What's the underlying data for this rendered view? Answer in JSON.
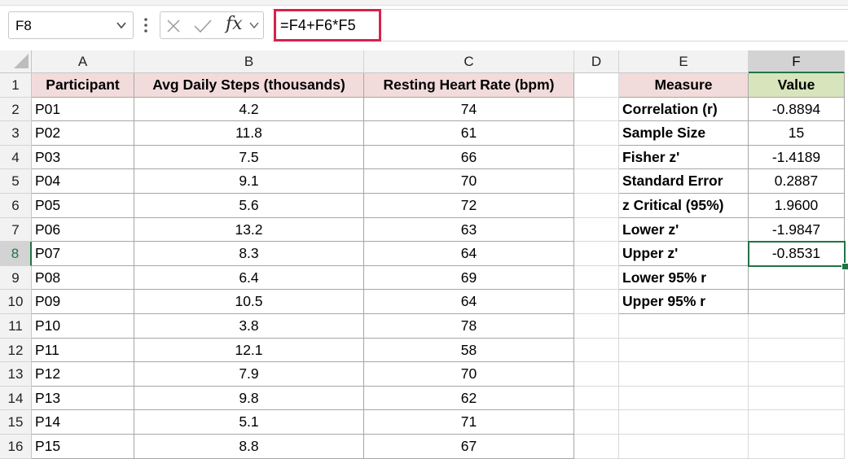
{
  "name_box": {
    "value": "F8"
  },
  "formula_bar": {
    "fx_label": "fx",
    "formula": "=F4+F6*F5"
  },
  "columns": [
    "A",
    "B",
    "C",
    "D",
    "E",
    "F"
  ],
  "rows": [
    "1",
    "2",
    "3",
    "4",
    "5",
    "6",
    "7",
    "8",
    "9",
    "10",
    "11",
    "12",
    "13",
    "14",
    "15",
    "16"
  ],
  "data_table": {
    "headers": [
      "Participant",
      "Avg Daily Steps (thousands)",
      "Resting Heart Rate (bpm)"
    ],
    "rows": [
      [
        "P01",
        "4.2",
        "74"
      ],
      [
        "P02",
        "11.8",
        "61"
      ],
      [
        "P03",
        "7.5",
        "66"
      ],
      [
        "P04",
        "9.1",
        "70"
      ],
      [
        "P05",
        "5.6",
        "72"
      ],
      [
        "P06",
        "13.2",
        "63"
      ],
      [
        "P07",
        "8.3",
        "64"
      ],
      [
        "P08",
        "6.4",
        "69"
      ],
      [
        "P09",
        "10.5",
        "64"
      ],
      [
        "P10",
        "3.8",
        "78"
      ],
      [
        "P11",
        "12.1",
        "58"
      ],
      [
        "P12",
        "7.9",
        "70"
      ],
      [
        "P13",
        "9.8",
        "62"
      ],
      [
        "P14",
        "5.1",
        "71"
      ],
      [
        "P15",
        "8.8",
        "67"
      ]
    ]
  },
  "stats_table": {
    "headers": [
      "Measure",
      "Value"
    ],
    "rows": [
      [
        "Correlation (r)",
        "-0.8894"
      ],
      [
        "Sample Size",
        "15"
      ],
      [
        "Fisher z'",
        "-1.4189"
      ],
      [
        "Standard Error",
        "0.2887"
      ],
      [
        "z Critical (95%)",
        "1.9600"
      ],
      [
        "Lower z'",
        "-1.9847"
      ],
      [
        "Upper z'",
        "-0.8531"
      ],
      [
        "Lower 95% r",
        ""
      ],
      [
        "Upper 95% r",
        ""
      ]
    ]
  },
  "colors": {
    "header_fill_pink": "#f2dcdb",
    "header_fill_green": "#d8e4bc",
    "selection": "#217346",
    "formula_highlight": "#d6224b"
  },
  "icons": [
    "chevron-down-icon",
    "more-vertical-icon",
    "cancel-x-icon",
    "enter-check-icon",
    "fx-icon"
  ]
}
